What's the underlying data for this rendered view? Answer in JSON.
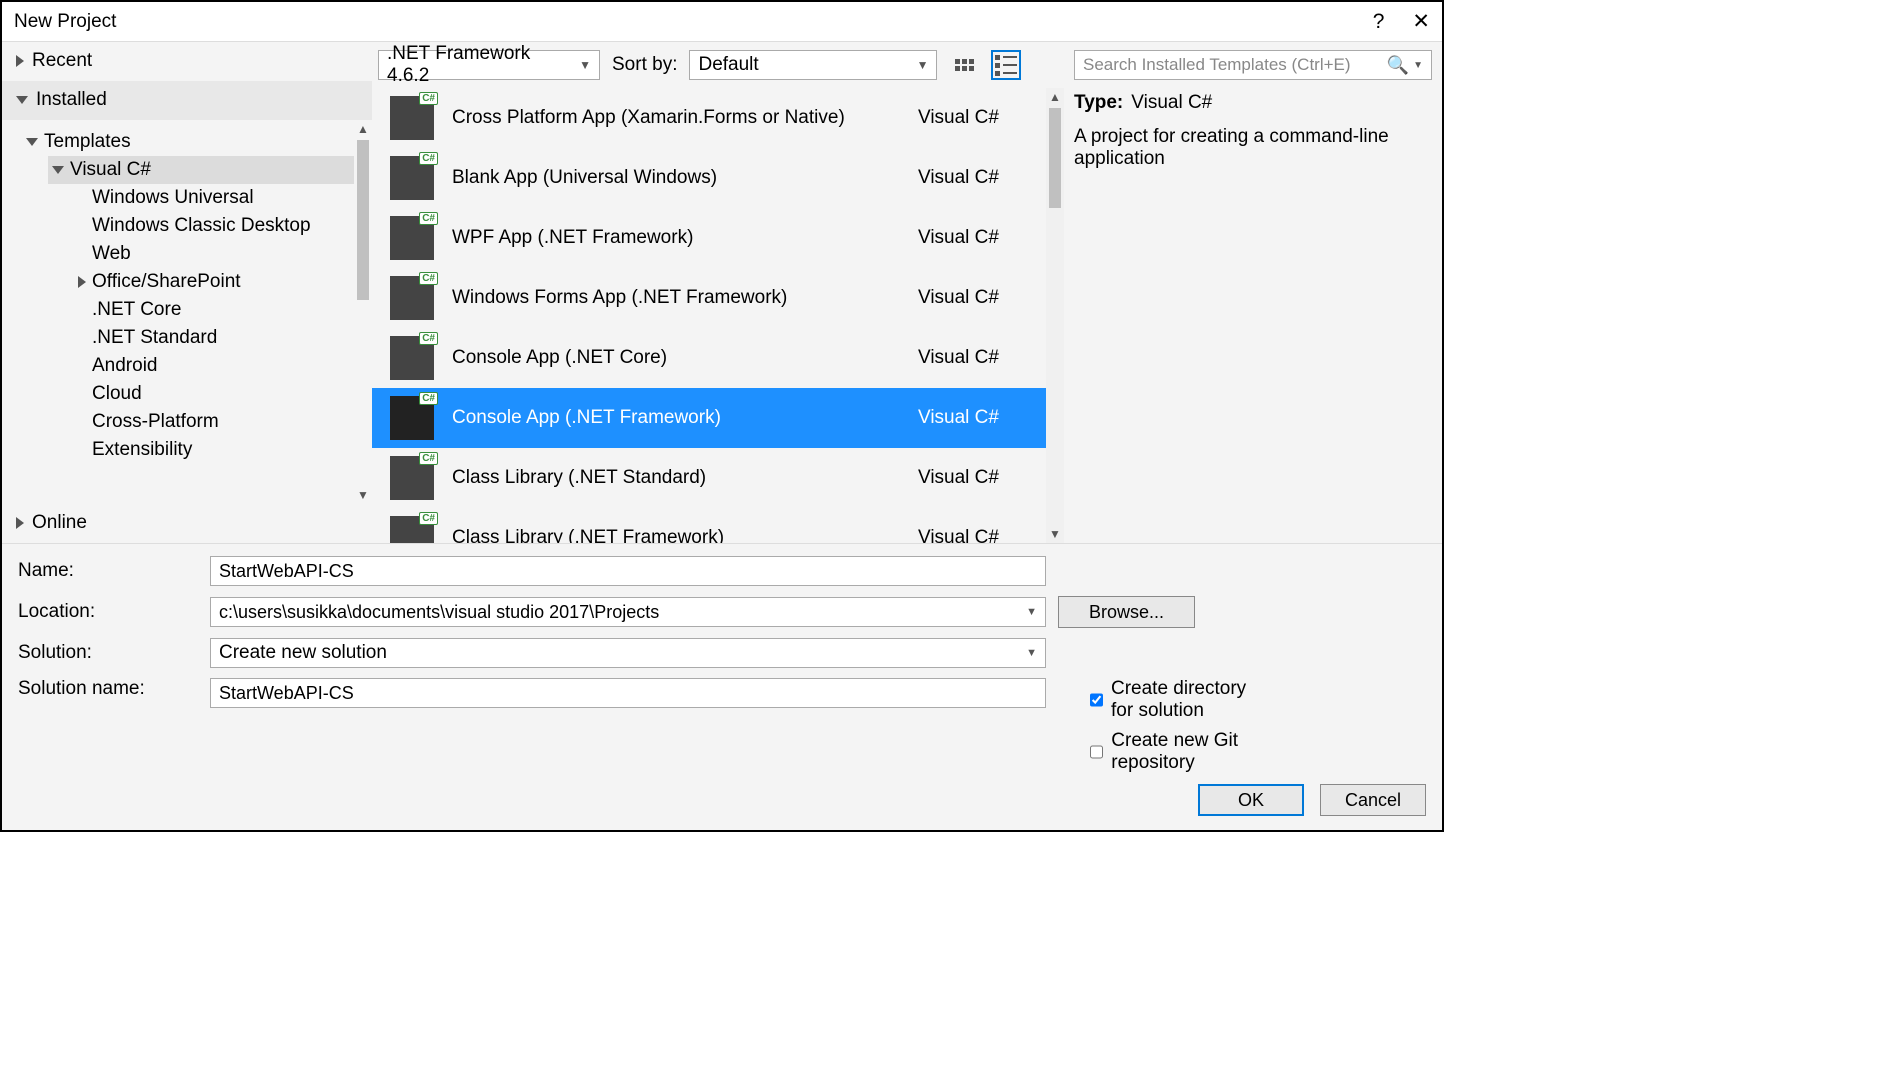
{
  "title": "New Project",
  "left": {
    "recent": "Recent",
    "installed": "Installed",
    "online": "Online",
    "templates": "Templates",
    "visualcs": "Visual C#",
    "children": [
      "Windows Universal",
      "Windows Classic Desktop",
      "Web",
      "Office/SharePoint",
      ".NET Core",
      ".NET Standard",
      "Android",
      "Cloud",
      "Cross-Platform",
      "Extensibility"
    ]
  },
  "toolbar": {
    "framework": ".NET Framework 4.6.2",
    "sortby_label": "Sort by:",
    "sortby_value": "Default"
  },
  "templates": [
    {
      "name": "Cross Platform App (Xamarin.Forms or Native)",
      "lang": "Visual C#"
    },
    {
      "name": "Blank App (Universal Windows)",
      "lang": "Visual C#"
    },
    {
      "name": "WPF App (.NET Framework)",
      "lang": "Visual C#"
    },
    {
      "name": "Windows Forms App (.NET Framework)",
      "lang": "Visual C#"
    },
    {
      "name": "Console App (.NET Core)",
      "lang": "Visual C#"
    },
    {
      "name": "Console App (.NET Framework)",
      "lang": "Visual C#",
      "selected": true
    },
    {
      "name": "Class Library (.NET Standard)",
      "lang": "Visual C#"
    },
    {
      "name": "Class Library (.NET Framework)",
      "lang": "Visual C#"
    }
  ],
  "right": {
    "search_placeholder": "Search Installed Templates (Ctrl+E)",
    "type_label": "Type:",
    "type_value": "Visual C#",
    "description": "A project for creating a command-line application"
  },
  "form": {
    "name_label": "Name:",
    "name_value": "StartWebAPI-CS",
    "location_label": "Location:",
    "location_value": "c:\\users\\susikka\\documents\\visual studio 2017\\Projects",
    "browse": "Browse...",
    "solution_label": "Solution:",
    "solution_value": "Create new solution",
    "solname_label": "Solution name:",
    "solname_value": "StartWebAPI-CS",
    "check1": "Create directory for solution",
    "check2": "Create new Git repository",
    "ok": "OK",
    "cancel": "Cancel"
  }
}
